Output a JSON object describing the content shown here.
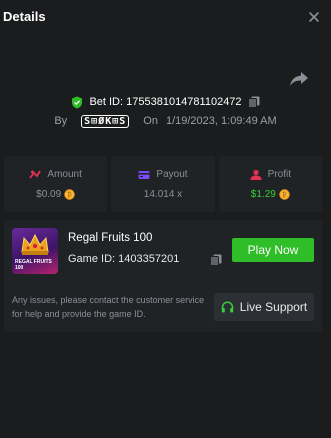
{
  "header": {
    "title": "Details"
  },
  "bet": {
    "id_label": "Bet ID:",
    "id_value": "1755381014781102472",
    "by_label": "By",
    "username": "S⊞ØK⊞S",
    "on_label": "On",
    "datetime": "1/19/2023, 1:09:49 AM"
  },
  "stats": [
    {
      "label": "Amount",
      "value": "$0.09",
      "icon": "amount-icon",
      "color": "#e0334f"
    },
    {
      "label": "Payout",
      "value": "14.014 x",
      "icon": "payout-icon",
      "color": "#7a4cff"
    },
    {
      "label": "Profit",
      "value": "$1.29",
      "icon": "profit-icon",
      "color": "#e0334f"
    }
  ],
  "game": {
    "name": "Regal Fruits 100",
    "id_label": "Game ID:",
    "id_value": "1403357201",
    "thumb_text": "REGAL FRUITS 100",
    "play_label": "Play Now"
  },
  "support": {
    "help_text": "Any issues, please contact the customer service for help and provide the game ID.",
    "button_label": "Live Support"
  },
  "colors": {
    "accent_green": "#2fbd28",
    "profit_green": "#34d13a",
    "background": "#1a1c1e",
    "panel": "#202326"
  }
}
